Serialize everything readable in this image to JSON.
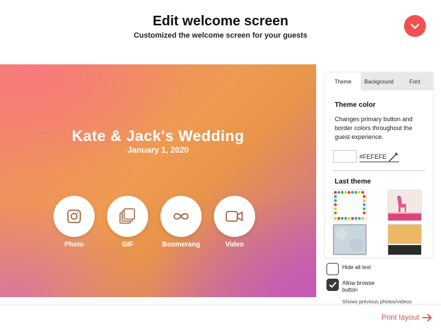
{
  "header": {
    "title": "Edit welcome screen",
    "subtitle": "Customized the welcome screen for your guests",
    "accent_color": "#f0524f",
    "collapse_icon": "chevron-down-icon"
  },
  "preview": {
    "event_title": "Kate & Jack's Wedding",
    "event_date": "January 1, 2020",
    "modes": [
      {
        "label": "Photo",
        "icon": "camera-icon"
      },
      {
        "label": "GIF",
        "icon": "gif-stack-icon"
      },
      {
        "label": "Boomerang",
        "icon": "infinity-icon"
      },
      {
        "label": "Video",
        "icon": "video-camera-icon"
      }
    ],
    "icon_color": "#a86a4a"
  },
  "panel": {
    "tabs": [
      {
        "label": "Theme",
        "active": true
      },
      {
        "label": "Background",
        "active": false
      },
      {
        "label": "Font",
        "active": false
      }
    ],
    "theme_color": {
      "title": "Theme color",
      "description": "Changes primary button and border colors throughout the guest experience.",
      "hex_value": "#FEFEFE",
      "eyedropper_icon": "eyedropper-icon"
    },
    "last_theme": {
      "title": "Last theme",
      "themes": [
        "polka-dot-border",
        "pink-giraffe",
        "light-blue-texture",
        "orange-black-band"
      ]
    }
  },
  "options": {
    "hide_all_text": {
      "label": "Hide all text",
      "checked": false
    },
    "allow_browse": {
      "label": "Allow browse button",
      "checked": true
    },
    "hint": "Shows previous photos/videos"
  },
  "footer": {
    "print_label": "Print layout",
    "print_icon": "arrow-right-icon"
  }
}
